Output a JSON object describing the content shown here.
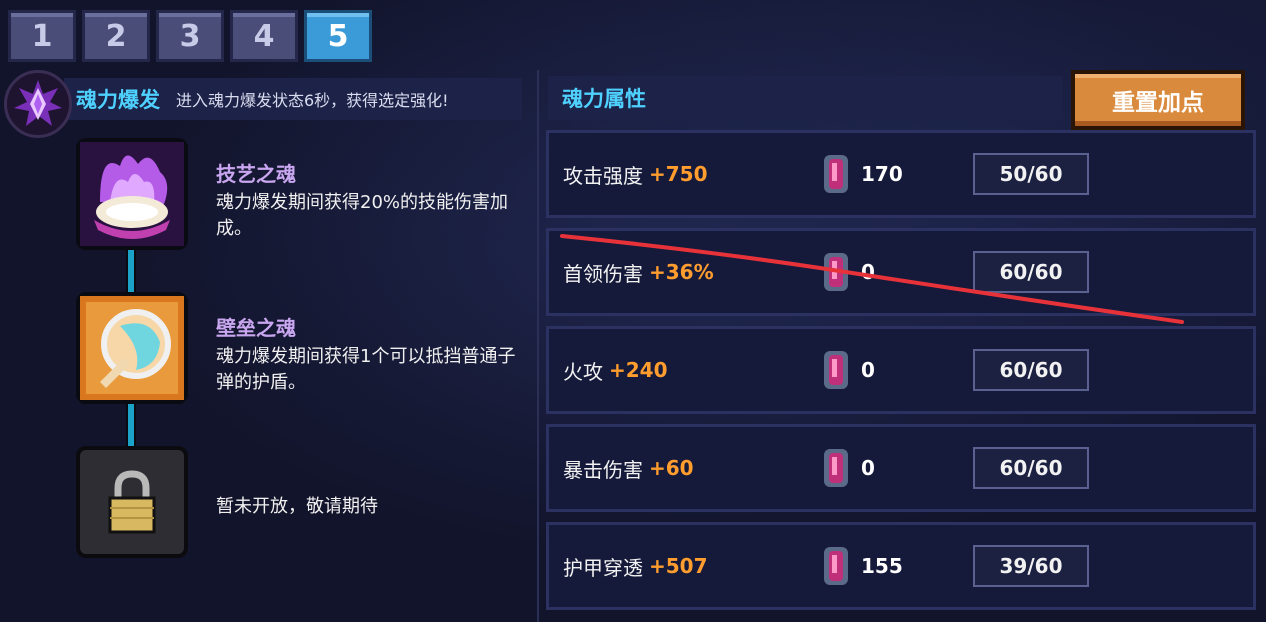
{
  "tabs": [
    "1",
    "2",
    "3",
    "4",
    "5"
  ],
  "active_tab": "5",
  "skill": {
    "name": "魂力爆发",
    "description": "进入魂力爆发状态6秒，获得选定强化!"
  },
  "nodes": [
    {
      "title": "技艺之魂",
      "description": "魂力爆发期间获得20%的技能伤害加成。"
    },
    {
      "title": "壁垒之魂",
      "description": "魂力爆发期间获得1个可以抵挡普通子弹的护盾。"
    },
    {
      "title": "",
      "description": "暂未开放，敬请期待"
    }
  ],
  "attributes_title": "魂力属性",
  "reset_button": "重置加点",
  "attributes": [
    {
      "name": "攻击强度",
      "bonus": "+750",
      "cost": "170",
      "level": "50/60"
    },
    {
      "name": "首领伤害",
      "bonus": "+36%",
      "cost": "0",
      "level": "60/60"
    },
    {
      "name": "火攻",
      "bonus": "+240",
      "cost": "0",
      "level": "60/60"
    },
    {
      "name": "暴击伤害",
      "bonus": "+60",
      "cost": "0",
      "level": "60/60"
    },
    {
      "name": "护甲穿透",
      "bonus": "+507",
      "cost": "155",
      "level": "39/60"
    }
  ],
  "colors": {
    "accent": "#4fd1ff",
    "bonus": "#ff9d2e",
    "annotation": "#e8323a"
  }
}
